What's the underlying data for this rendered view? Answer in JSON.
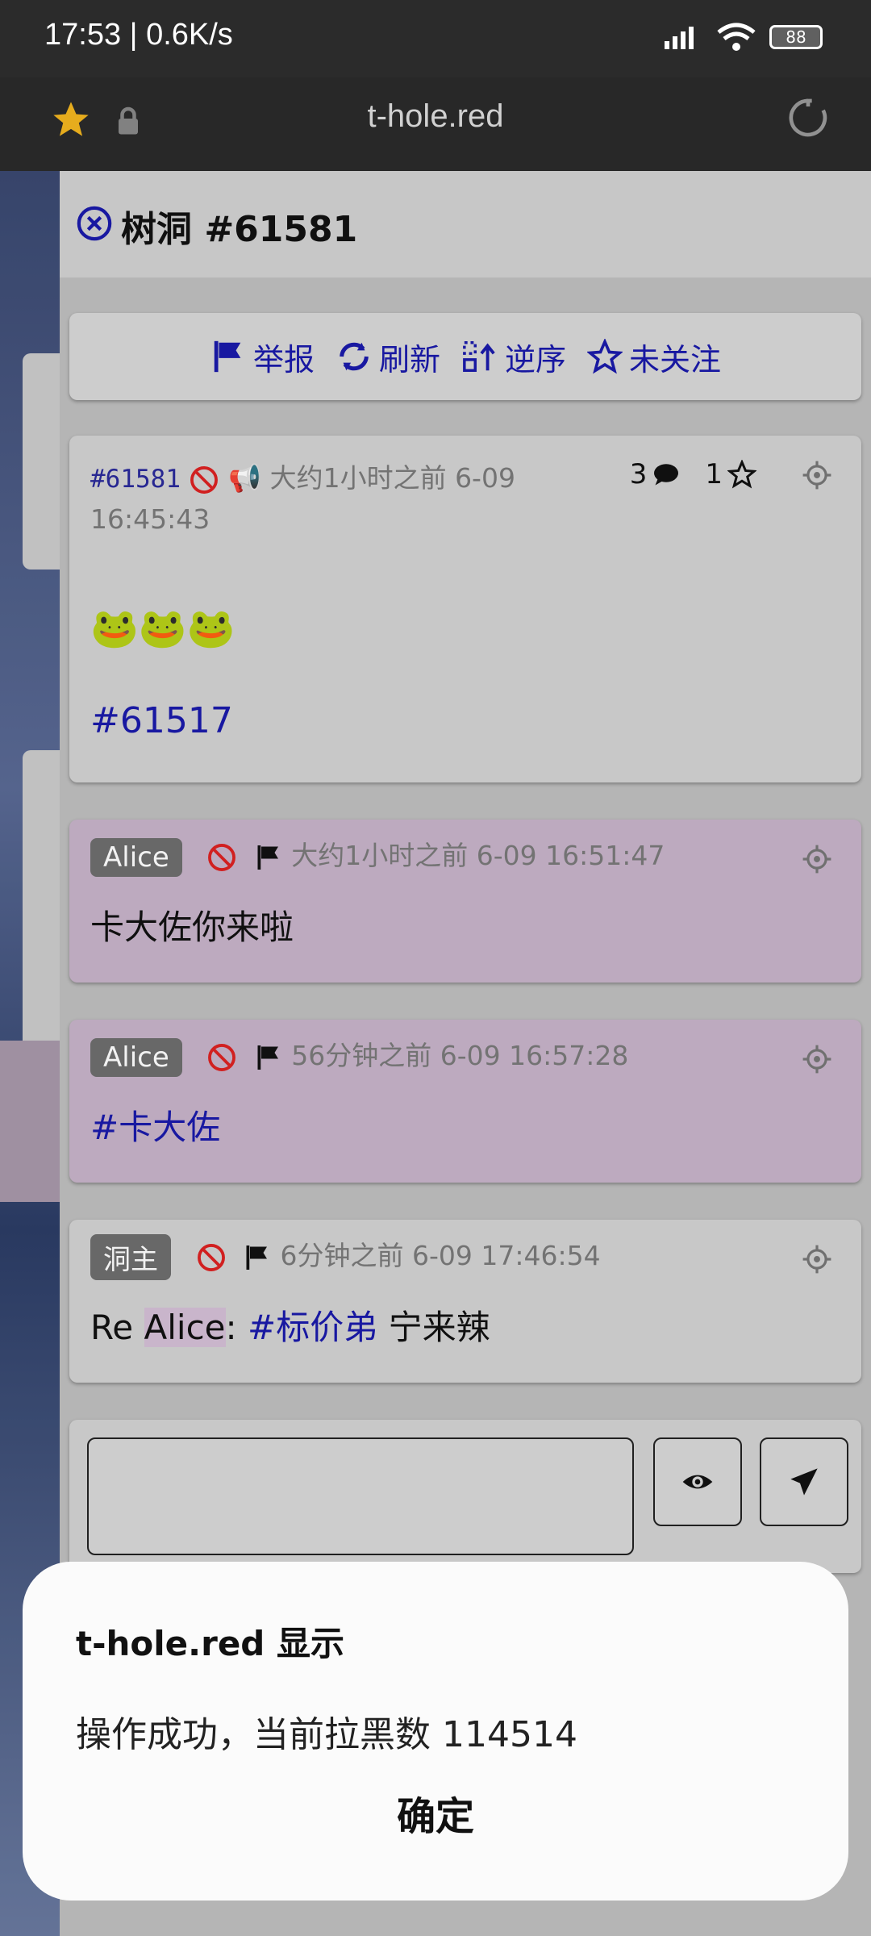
{
  "status_bar": {
    "time": "17:53 | 0.6K/s",
    "battery": "88"
  },
  "browser": {
    "url": "t-hole.red"
  },
  "panel": {
    "title": "树洞 #61581",
    "toolbar": {
      "report": "举报",
      "refresh": "刷新",
      "reverse": "逆序",
      "follow": "未关注"
    },
    "main_post": {
      "id": "#61581",
      "time_line1": "大约1小时之前 6-09",
      "time_line2": "16:45:43",
      "reply_count": "3",
      "star_count": "1",
      "emoji": "🐸🐸🐸",
      "link": "#61517"
    },
    "replies": [
      {
        "author": "Alice",
        "time": "大约1小时之前 6-09 16:51:47",
        "text": "卡大佐你来啦"
      },
      {
        "author": "Alice",
        "time": "56分钟之前 6-09 16:57:28",
        "text": "#卡大佐"
      },
      {
        "author": "洞主",
        "time": "6分钟之前 6-09 17:46:54",
        "text_prefix": "Re ",
        "mention": "Alice",
        "text_colon": ": ",
        "tag": "#标价弟",
        "text_suffix": " 宁来辣"
      }
    ]
  },
  "dialog": {
    "title": "t-hole.red 显示",
    "message": "操作成功，当前拉黑数 114514",
    "ok_label": "确定"
  }
}
